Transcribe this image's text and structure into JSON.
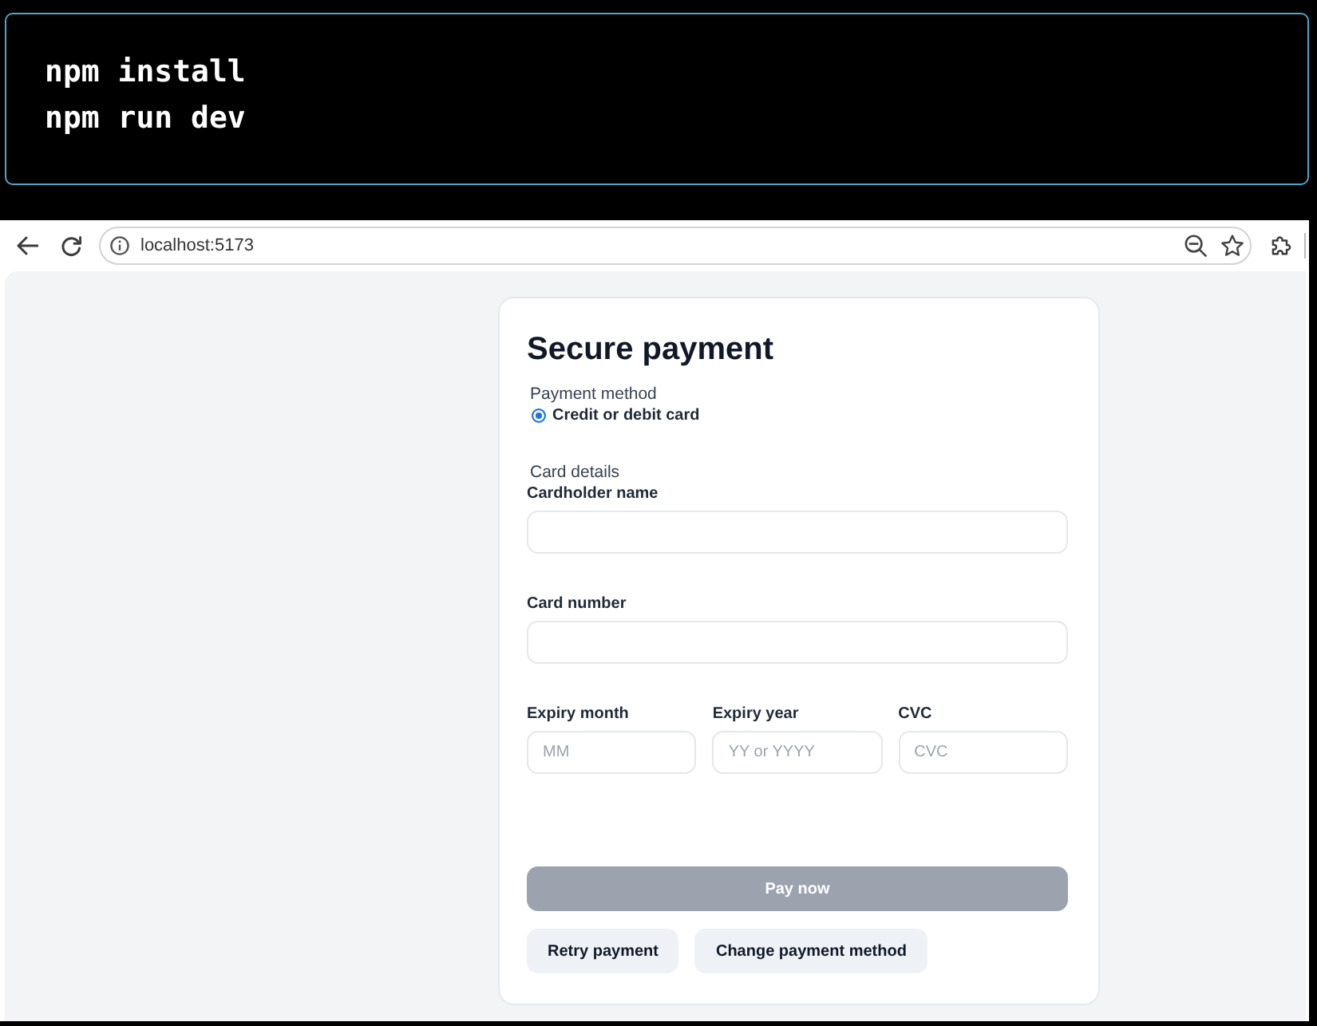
{
  "terminal": {
    "lines": [
      "npm install",
      "npm run dev"
    ]
  },
  "browser": {
    "address": "localhost:5173"
  },
  "form": {
    "title": "Secure payment",
    "payment_method": {
      "legend": "Payment method",
      "options": [
        {
          "label": "Credit or debit card",
          "selected": true
        }
      ]
    },
    "card_details": {
      "legend": "Card details",
      "rows": [
        {
          "fields": [
            {
              "label": "Cardholder name"
            }
          ]
        },
        {
          "fields": [
            {
              "label": "Card number"
            }
          ]
        },
        {
          "fields": [
            {
              "label": "Expiry month",
              "placeholder": "MM"
            },
            {
              "label": "Expiry year",
              "placeholder": "YY or YYYY"
            },
            {
              "label": "CVC",
              "placeholder": "CVC"
            }
          ]
        }
      ]
    },
    "buttons": [
      {
        "label": "Pay now",
        "kind": "primary",
        "disabled": true
      },
      {
        "label": "Retry payment",
        "kind": "secondary",
        "disabled": false
      },
      {
        "label": "Change payment method",
        "kind": "secondary",
        "disabled": false
      }
    ]
  }
}
